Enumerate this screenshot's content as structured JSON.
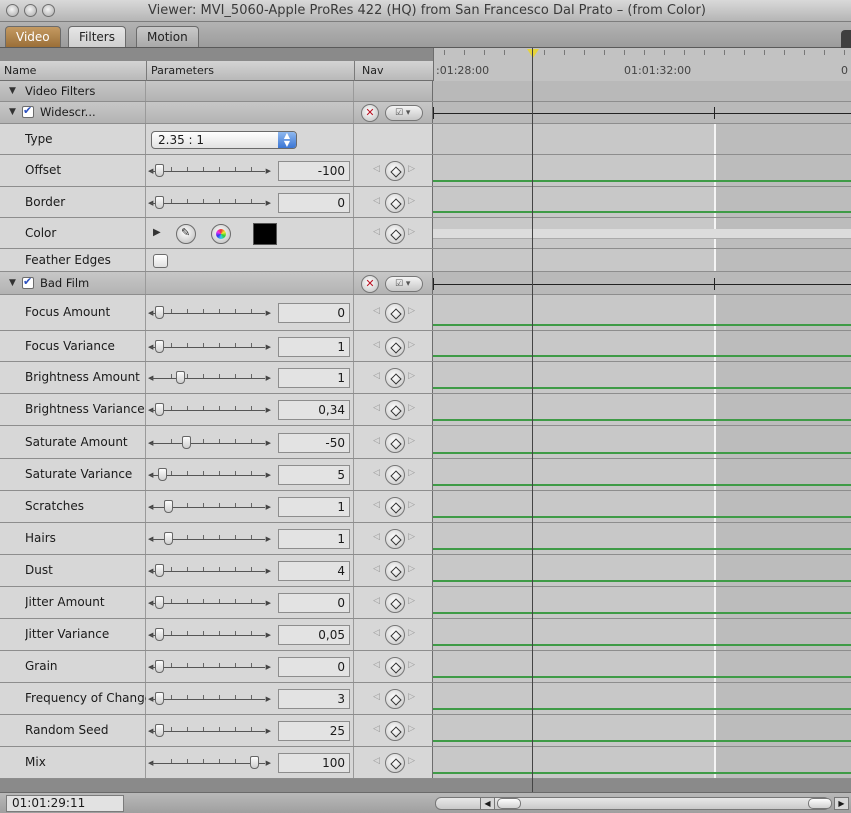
{
  "window": {
    "title": "Viewer: MVI_5060-Apple ProRes 422 (HQ) from San Francesco Dal Prato – (from Color)"
  },
  "tabs": [
    "Video",
    "Filters",
    "Motion"
  ],
  "active_tab": "Filters",
  "columns": {
    "name": "Name",
    "parameters": "Parameters",
    "nav": "Nav"
  },
  "ruler": {
    "tc_left": ":01:28:00",
    "tc_mid": "01:01:32:00",
    "tc_right": "0"
  },
  "icons": {
    "disclosure": "disclosure-triangle-icon",
    "reset": "reset-x-icon",
    "menu": "filter-menu-icon",
    "keyframe": "keyframe-diamond-icon",
    "eyedropper": "eyedropper-icon",
    "color_picker": "color-picker-icon"
  },
  "colors": {
    "video_tab": "#b38648",
    "keyframe_line": "#3f9b47",
    "popup_arrow": "#3b76d4",
    "swatch": "#000000",
    "playhead": "#e6d43a"
  },
  "sections": {
    "video_filters": {
      "label": "Video Filters"
    },
    "widescreen": {
      "label": "Widescr...",
      "type": {
        "label": "Type",
        "value": "2.35 : 1"
      },
      "offset": {
        "label": "Offset",
        "value": "-100",
        "pos": 0.04
      },
      "border": {
        "label": "Border",
        "value": "0",
        "pos": 0.04
      },
      "color": {
        "label": "Color"
      },
      "feather": {
        "label": "Feather Edges"
      }
    },
    "bad_film": {
      "label": "Bad Film",
      "params": [
        {
          "label": "Focus Amount",
          "value": "0",
          "pos": 0.04
        },
        {
          "label": "Focus Variance",
          "value": "1",
          "pos": 0.04
        },
        {
          "label": "Brightness Amount",
          "value": "1",
          "pos": 0.24
        },
        {
          "label": "Brightness Variance",
          "value": "0,34",
          "pos": 0.04
        },
        {
          "label": "Saturate Amount",
          "value": "-50",
          "pos": 0.29
        },
        {
          "label": "Saturate Variance",
          "value": "5",
          "pos": 0.07
        },
        {
          "label": "Scratches",
          "value": "1",
          "pos": 0.12
        },
        {
          "label": "Hairs",
          "value": "1",
          "pos": 0.12
        },
        {
          "label": "Dust",
          "value": "4",
          "pos": 0.04
        },
        {
          "label": "Jitter Amount",
          "value": "0",
          "pos": 0.04
        },
        {
          "label": "Jitter Variance",
          "value": "0,05",
          "pos": 0.04
        },
        {
          "label": "Grain",
          "value": "0",
          "pos": 0.04
        },
        {
          "label": "Frequency of Change",
          "value": "3",
          "pos": 0.04
        },
        {
          "label": "Random Seed",
          "value": "25",
          "pos": 0.04
        },
        {
          "label": "Mix",
          "value": "100",
          "pos": 0.93
        }
      ]
    }
  },
  "footer": {
    "timecode": "01:01:29:11"
  }
}
